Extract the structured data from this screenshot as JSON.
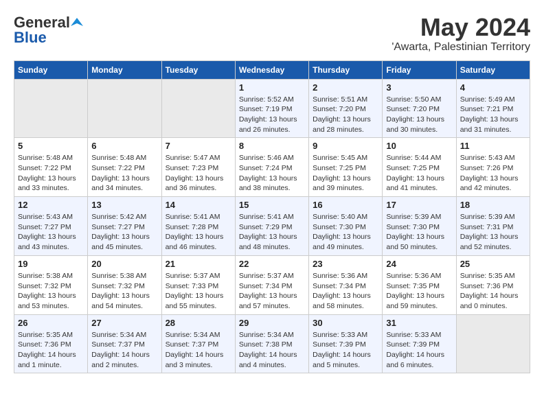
{
  "header": {
    "logo_general": "General",
    "logo_blue": "Blue",
    "month": "May 2024",
    "location": "'Awarta, Palestinian Territory"
  },
  "weekdays": [
    "Sunday",
    "Monday",
    "Tuesday",
    "Wednesday",
    "Thursday",
    "Friday",
    "Saturday"
  ],
  "weeks": [
    [
      {
        "day": "",
        "info": ""
      },
      {
        "day": "",
        "info": ""
      },
      {
        "day": "",
        "info": ""
      },
      {
        "day": "1",
        "info": "Sunrise: 5:52 AM\nSunset: 7:19 PM\nDaylight: 13 hours and 26 minutes."
      },
      {
        "day": "2",
        "info": "Sunrise: 5:51 AM\nSunset: 7:20 PM\nDaylight: 13 hours and 28 minutes."
      },
      {
        "day": "3",
        "info": "Sunrise: 5:50 AM\nSunset: 7:20 PM\nDaylight: 13 hours and 30 minutes."
      },
      {
        "day": "4",
        "info": "Sunrise: 5:49 AM\nSunset: 7:21 PM\nDaylight: 13 hours and 31 minutes."
      }
    ],
    [
      {
        "day": "5",
        "info": "Sunrise: 5:48 AM\nSunset: 7:22 PM\nDaylight: 13 hours and 33 minutes."
      },
      {
        "day": "6",
        "info": "Sunrise: 5:48 AM\nSunset: 7:22 PM\nDaylight: 13 hours and 34 minutes."
      },
      {
        "day": "7",
        "info": "Sunrise: 5:47 AM\nSunset: 7:23 PM\nDaylight: 13 hours and 36 minutes."
      },
      {
        "day": "8",
        "info": "Sunrise: 5:46 AM\nSunset: 7:24 PM\nDaylight: 13 hours and 38 minutes."
      },
      {
        "day": "9",
        "info": "Sunrise: 5:45 AM\nSunset: 7:25 PM\nDaylight: 13 hours and 39 minutes."
      },
      {
        "day": "10",
        "info": "Sunrise: 5:44 AM\nSunset: 7:25 PM\nDaylight: 13 hours and 41 minutes."
      },
      {
        "day": "11",
        "info": "Sunrise: 5:43 AM\nSunset: 7:26 PM\nDaylight: 13 hours and 42 minutes."
      }
    ],
    [
      {
        "day": "12",
        "info": "Sunrise: 5:43 AM\nSunset: 7:27 PM\nDaylight: 13 hours and 43 minutes."
      },
      {
        "day": "13",
        "info": "Sunrise: 5:42 AM\nSunset: 7:27 PM\nDaylight: 13 hours and 45 minutes."
      },
      {
        "day": "14",
        "info": "Sunrise: 5:41 AM\nSunset: 7:28 PM\nDaylight: 13 hours and 46 minutes."
      },
      {
        "day": "15",
        "info": "Sunrise: 5:41 AM\nSunset: 7:29 PM\nDaylight: 13 hours and 48 minutes."
      },
      {
        "day": "16",
        "info": "Sunrise: 5:40 AM\nSunset: 7:30 PM\nDaylight: 13 hours and 49 minutes."
      },
      {
        "day": "17",
        "info": "Sunrise: 5:39 AM\nSunset: 7:30 PM\nDaylight: 13 hours and 50 minutes."
      },
      {
        "day": "18",
        "info": "Sunrise: 5:39 AM\nSunset: 7:31 PM\nDaylight: 13 hours and 52 minutes."
      }
    ],
    [
      {
        "day": "19",
        "info": "Sunrise: 5:38 AM\nSunset: 7:32 PM\nDaylight: 13 hours and 53 minutes."
      },
      {
        "day": "20",
        "info": "Sunrise: 5:38 AM\nSunset: 7:32 PM\nDaylight: 13 hours and 54 minutes."
      },
      {
        "day": "21",
        "info": "Sunrise: 5:37 AM\nSunset: 7:33 PM\nDaylight: 13 hours and 55 minutes."
      },
      {
        "day": "22",
        "info": "Sunrise: 5:37 AM\nSunset: 7:34 PM\nDaylight: 13 hours and 57 minutes."
      },
      {
        "day": "23",
        "info": "Sunrise: 5:36 AM\nSunset: 7:34 PM\nDaylight: 13 hours and 58 minutes."
      },
      {
        "day": "24",
        "info": "Sunrise: 5:36 AM\nSunset: 7:35 PM\nDaylight: 13 hours and 59 minutes."
      },
      {
        "day": "25",
        "info": "Sunrise: 5:35 AM\nSunset: 7:36 PM\nDaylight: 14 hours and 0 minutes."
      }
    ],
    [
      {
        "day": "26",
        "info": "Sunrise: 5:35 AM\nSunset: 7:36 PM\nDaylight: 14 hours and 1 minute."
      },
      {
        "day": "27",
        "info": "Sunrise: 5:34 AM\nSunset: 7:37 PM\nDaylight: 14 hours and 2 minutes."
      },
      {
        "day": "28",
        "info": "Sunrise: 5:34 AM\nSunset: 7:37 PM\nDaylight: 14 hours and 3 minutes."
      },
      {
        "day": "29",
        "info": "Sunrise: 5:34 AM\nSunset: 7:38 PM\nDaylight: 14 hours and 4 minutes."
      },
      {
        "day": "30",
        "info": "Sunrise: 5:33 AM\nSunset: 7:39 PM\nDaylight: 14 hours and 5 minutes."
      },
      {
        "day": "31",
        "info": "Sunrise: 5:33 AM\nSunset: 7:39 PM\nDaylight: 14 hours and 6 minutes."
      },
      {
        "day": "",
        "info": ""
      }
    ]
  ]
}
